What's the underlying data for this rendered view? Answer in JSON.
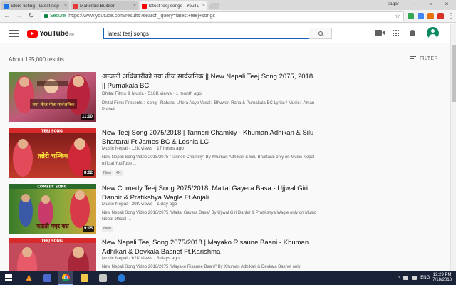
{
  "browser": {
    "tabs": [
      {
        "label": "Store listing - latest nep",
        "icon": "store-icon",
        "color": "#1a73e8"
      },
      {
        "label": "Makeroid Builder",
        "icon": "makeroid-icon",
        "color": "#e53935"
      },
      {
        "label": "latest teej songs - YouTu",
        "icon": "youtube-icon",
        "color": "#ff0000"
      }
    ],
    "profile_name": "sagar",
    "secure_label": "Secure",
    "url": "https://www.youtube.com/results?search_query=latest+teej+songs"
  },
  "youtube": {
    "logo_text": "YouTube",
    "region": "NP",
    "search_query": "latest teej songs",
    "results_count": "About 195,000 results",
    "filter_label": "FILTER"
  },
  "videos": [
    {
      "title": "अन्जली अधिकारीको नया तीज सार्वजनिक || New Nepali Teej Song 2075, 2018 || Purnakala BC",
      "channel": "Dhital Films & Music",
      "views": "518K views",
      "age": "1 month ago",
      "description": "Dhital Films Presents :- song:- Raharai Urlera Aayo Vocal:- Bhuwan Rana & Purnakala BC Lyrics / Music:- Aman Purbeli ...",
      "duration": "11:00",
      "thumb_text": "नया तीज गीत सार्वजनिक",
      "badges": []
    },
    {
      "title": "New Teej Song 2075/2018 | Tanneri Chamkiy - Khuman Adhikari & Silu Bhattarai Ft.James BC & Loshia LC",
      "channel": "Music Nepal",
      "views": "12K views",
      "age": "17 hours ago",
      "description": "New Nepali Song Video 2018/2075 \"Tanneri Chamkiy\" By Khuman Adhikari & Silu Bhattarai only on Music Nepal official YouTube ...",
      "duration": "8:02",
      "thumb_text": "तन्नेरी चम्किय",
      "thumb_tag": "TEEJ SONG",
      "badges": [
        "New",
        "4K"
      ]
    },
    {
      "title": "New Comedy Teej Song 2075/2018| Maitai Gayera Basa - Ujjwal Giri Danbir & Pratikshya Wagle Ft.Anjali",
      "channel": "Music Nepal",
      "views": "29K views",
      "age": "1 day ago",
      "description": "New Nepali Song Video 2018/2075 \"Maitai Gayera Basa\" By Ujjwal Giri Danbir & Pratikshya Wagle only on Music Nepal official ...",
      "duration": "9:05",
      "thumb_text": "माइती गएर बस",
      "thumb_tag": "COMEDY   SONG",
      "badges": [
        "New"
      ]
    },
    {
      "title": "New Nepali Teej Song 2075/2018 | Mayako Risaune Baani - Khuman Adhikari & Devkala Basnet Ft.Karishma",
      "channel": "Music Nepal",
      "views": "62K views",
      "age": "3 days ago",
      "description": "New Nepali Song Video 2018/2075 \"Mayako Risaune Baani\" By Khuman Adhikari & Devkala Basnet only",
      "duration": "",
      "thumb_tag": "TEEJ SONG",
      "badges": []
    }
  ],
  "taskbar": {
    "language": "ENG",
    "time": "12:29 PM",
    "date": "7/18/2018"
  }
}
